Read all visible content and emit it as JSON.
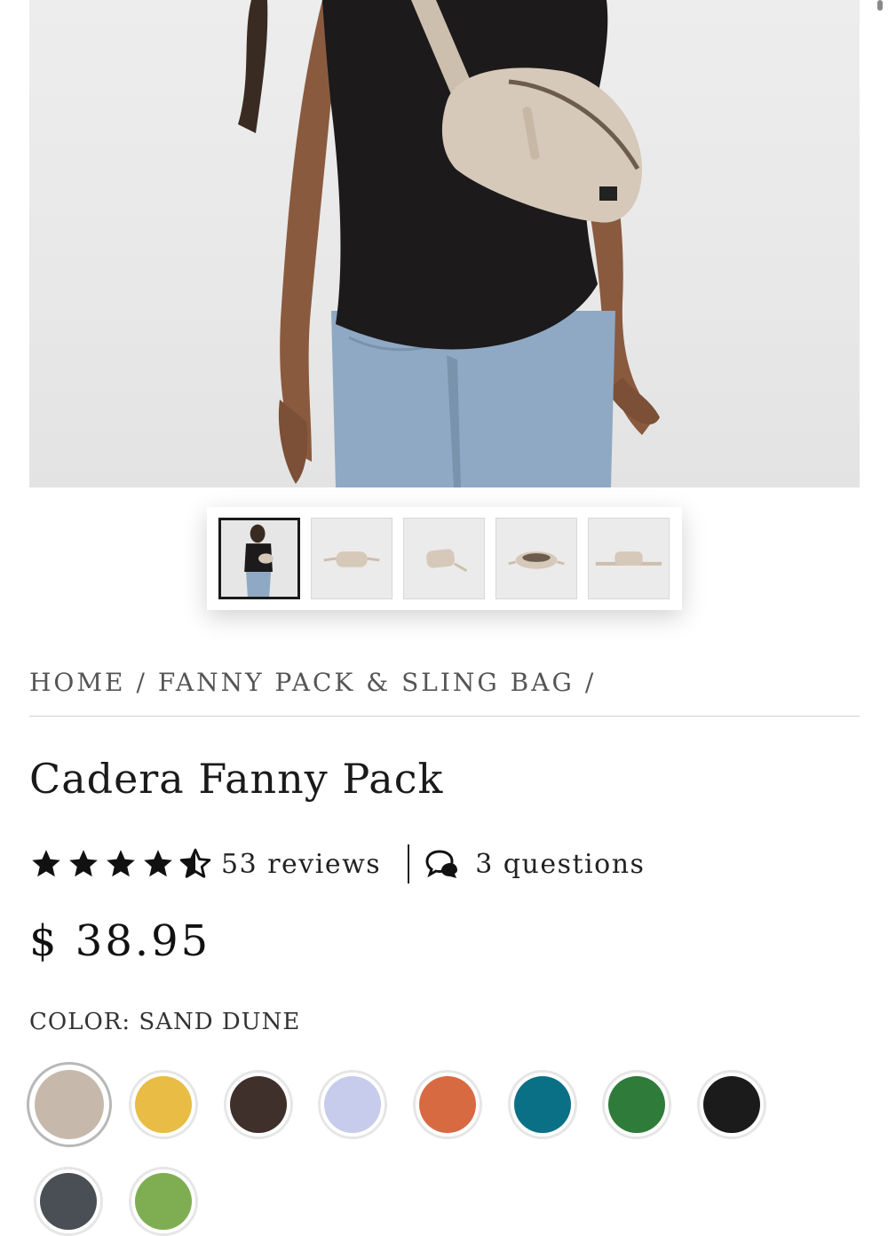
{
  "gallery": {
    "hero_image": "woman-wearing-sand-fanny-pack-crossbody",
    "thumbnails": [
      {
        "name": "model-wearing-pack"
      },
      {
        "name": "pack-front-view"
      },
      {
        "name": "pack-angled-view"
      },
      {
        "name": "pack-open-view"
      },
      {
        "name": "pack-flat-strap-view"
      }
    ],
    "active_index": 0
  },
  "breadcrumb": {
    "home": "HOME",
    "category": "FANNY PACK & SLING BAG",
    "separator": "/"
  },
  "product": {
    "title": "Cadera Fanny Pack",
    "rating": 4.5,
    "reviews_label": "53 reviews",
    "questions_label": "3 questions",
    "price": "$ 38.95",
    "color_label": "COLOR: SAND DUNE"
  },
  "swatches": [
    {
      "name": "sand-dune",
      "color": "#c6b9ac",
      "selected": true
    },
    {
      "name": "mustard",
      "color": "#e8bc45"
    },
    {
      "name": "dark-brown",
      "color": "#3f302b"
    },
    {
      "name": "lavender",
      "color": "#c7cbec"
    },
    {
      "name": "burnt-orange",
      "color": "#d86a42"
    },
    {
      "name": "teal",
      "color": "#0a7085"
    },
    {
      "name": "forest-green",
      "color": "#2f7b3a"
    },
    {
      "name": "black",
      "color": "#1b1b1b"
    },
    {
      "name": "charcoal",
      "color": "#4a4f56"
    },
    {
      "name": "sage-green",
      "color": "#7fae52"
    }
  ],
  "colors": {
    "text": "#1a1a1a",
    "muted": "#555555",
    "rule": "#d0d0d0"
  }
}
